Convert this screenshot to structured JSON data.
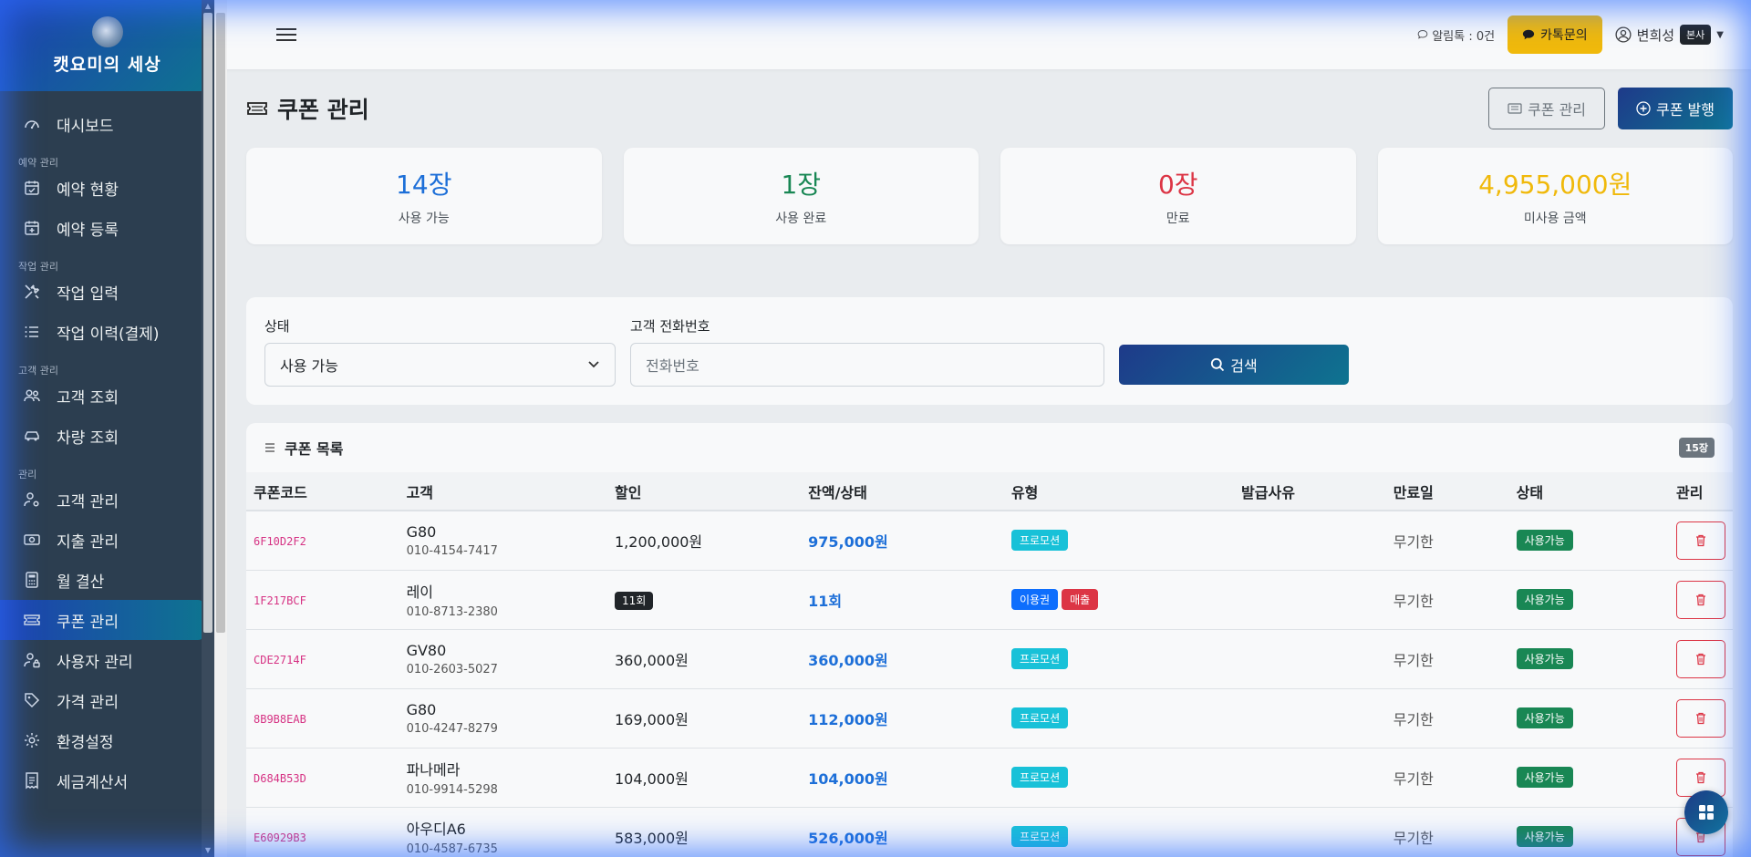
{
  "brand": {
    "name": "캣요미의 세상"
  },
  "sidebar": {
    "items": [
      {
        "type": "item",
        "label": "대시보드",
        "icon": "dashboard-icon"
      },
      {
        "type": "section",
        "label": "예약 관리"
      },
      {
        "type": "item",
        "label": "예약 현황",
        "icon": "calendar-check-icon"
      },
      {
        "type": "item",
        "label": "예약 등록",
        "icon": "calendar-plus-icon"
      },
      {
        "type": "section",
        "label": "작업 관리"
      },
      {
        "type": "item",
        "label": "작업 입력",
        "icon": "tools-icon"
      },
      {
        "type": "item",
        "label": "작업 이력(결제)",
        "icon": "list-icon"
      },
      {
        "type": "section",
        "label": "고객 관리"
      },
      {
        "type": "item",
        "label": "고객 조회",
        "icon": "people-icon"
      },
      {
        "type": "item",
        "label": "차량 조회",
        "icon": "car-icon"
      },
      {
        "type": "section",
        "label": "관리"
      },
      {
        "type": "item",
        "label": "고객 관리",
        "icon": "person-gear-icon"
      },
      {
        "type": "item",
        "label": "지출 관리",
        "icon": "cash-icon"
      },
      {
        "type": "item",
        "label": "월 결산",
        "icon": "calculator-icon"
      },
      {
        "type": "item",
        "label": "쿠폰 관리",
        "icon": "ticket-icon",
        "active": true
      },
      {
        "type": "item",
        "label": "사용자 관리",
        "icon": "person-lock-icon"
      },
      {
        "type": "item",
        "label": "가격 관리",
        "icon": "tags-icon"
      },
      {
        "type": "item",
        "label": "환경설정",
        "icon": "gear-icon"
      },
      {
        "type": "item",
        "label": "세금계산서",
        "icon": "receipt-icon"
      }
    ]
  },
  "topbar": {
    "alarm_text": "알림톡 : 0건",
    "kakao_label": "카톡문의",
    "user_name": "변희성",
    "user_badge": "본사"
  },
  "page": {
    "title": "쿠폰 관리",
    "btn_manage": "쿠폰 관리",
    "btn_issue": "쿠폰 발행"
  },
  "stats": [
    {
      "value": "14",
      "unit": "장",
      "label": "사용 가능",
      "color": "#1d6fd8"
    },
    {
      "value": "1",
      "unit": "장",
      "label": "사용 완료",
      "color": "#198754"
    },
    {
      "value": "0",
      "unit": "장",
      "label": "만료",
      "color": "#dc3545"
    },
    {
      "value": "4,955,000",
      "unit": "원",
      "label": "미사용 금액",
      "color": "#f0b90b"
    }
  ],
  "filter": {
    "status_label": "상태",
    "status_value": "사용 가능",
    "phone_label": "고객 전화번호",
    "phone_placeholder": "전화번호",
    "search_label": "검색"
  },
  "list": {
    "title": "쿠폰 목록",
    "count": "15장",
    "headers": [
      "쿠폰코드",
      "고객",
      "할인",
      "잔액/상태",
      "유형",
      "발급사유",
      "만료일",
      "상태",
      "관리"
    ],
    "rows": [
      {
        "code": "6F10D2F2",
        "name": "G80",
        "phone": "010-4154-7417",
        "discount": "1,200,000원",
        "discount_badge": "",
        "balance": "975,000원",
        "types": [
          "프로모션"
        ],
        "reason": "",
        "expire": "무기한",
        "status": "사용가능"
      },
      {
        "code": "1F217BCF",
        "name": "레이",
        "phone": "010-8713-2380",
        "discount": "",
        "discount_badge": "11회",
        "balance": "11회",
        "types": [
          "이용권",
          "매출"
        ],
        "reason": "",
        "expire": "무기한",
        "status": "사용가능"
      },
      {
        "code": "CDE2714F",
        "name": "GV80",
        "phone": "010-2603-5027",
        "discount": "360,000원",
        "discount_badge": "",
        "balance": "360,000원",
        "types": [
          "프로모션"
        ],
        "reason": "",
        "expire": "무기한",
        "status": "사용가능"
      },
      {
        "code": "8B9B8EAB",
        "name": "G80",
        "phone": "010-4247-8279",
        "discount": "169,000원",
        "discount_badge": "",
        "balance": "112,000원",
        "types": [
          "프로모션"
        ],
        "reason": "",
        "expire": "무기한",
        "status": "사용가능"
      },
      {
        "code": "D684B53D",
        "name": "파나메라",
        "phone": "010-9914-5298",
        "discount": "104,000원",
        "discount_badge": "",
        "balance": "104,000원",
        "types": [
          "프로모션"
        ],
        "reason": "",
        "expire": "무기한",
        "status": "사용가능"
      },
      {
        "code": "E60929B3",
        "name": "아우디A6",
        "phone": "010-4587-6735",
        "discount": "583,000원",
        "discount_badge": "",
        "balance": "526,000원",
        "types": [
          "프로모션"
        ],
        "reason": "",
        "expire": "무기한",
        "status": "사용가능"
      }
    ]
  }
}
